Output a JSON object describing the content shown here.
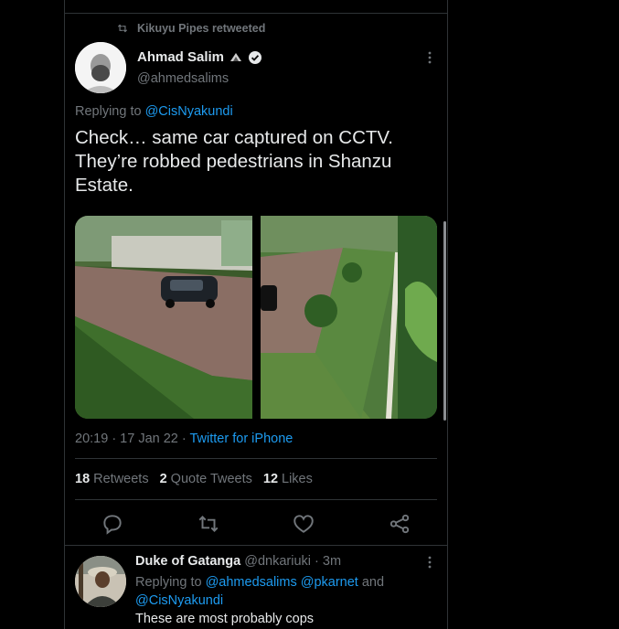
{
  "retweet": {
    "label": "Kikuyu Pipes retweeted",
    "icon": "retweet-icon"
  },
  "tweet": {
    "author_name": "Ahmad Salim",
    "handle": "@ahmedsalims",
    "replying_prefix": "Replying to ",
    "replying_to": "@CisNyakundi",
    "text_line1": "Check… same car captured on CCTV.",
    "text_line2": "They’re robbed pedestrians in Shanzu",
    "text_line3": "Estate.",
    "timestamp": "20:19 · 17 Jan 22 · ",
    "source": "Twitter for iPhone",
    "stats": {
      "retweets_count": "18",
      "retweets_label": "Retweets",
      "quotes_count": "2",
      "quotes_label": "Quote Tweets",
      "likes_count": "12",
      "likes_label": "Likes"
    }
  },
  "reply": {
    "author_name": "Duke of Gatanga",
    "handle_time": " @dnkariuki · 3m",
    "replying_prefix": "Replying to ",
    "replying_to_1": "@ahmedsalims",
    "replying_to_2": " @pkarnet",
    "replying_and": " and",
    "replying_to_3": "@CisNyakundi",
    "text": "These are most probably cops"
  },
  "colors": {
    "background": "#000000",
    "text": "#e7e9ea",
    "muted": "#71767b",
    "link": "#1d9bf0",
    "border": "#2f3336"
  }
}
